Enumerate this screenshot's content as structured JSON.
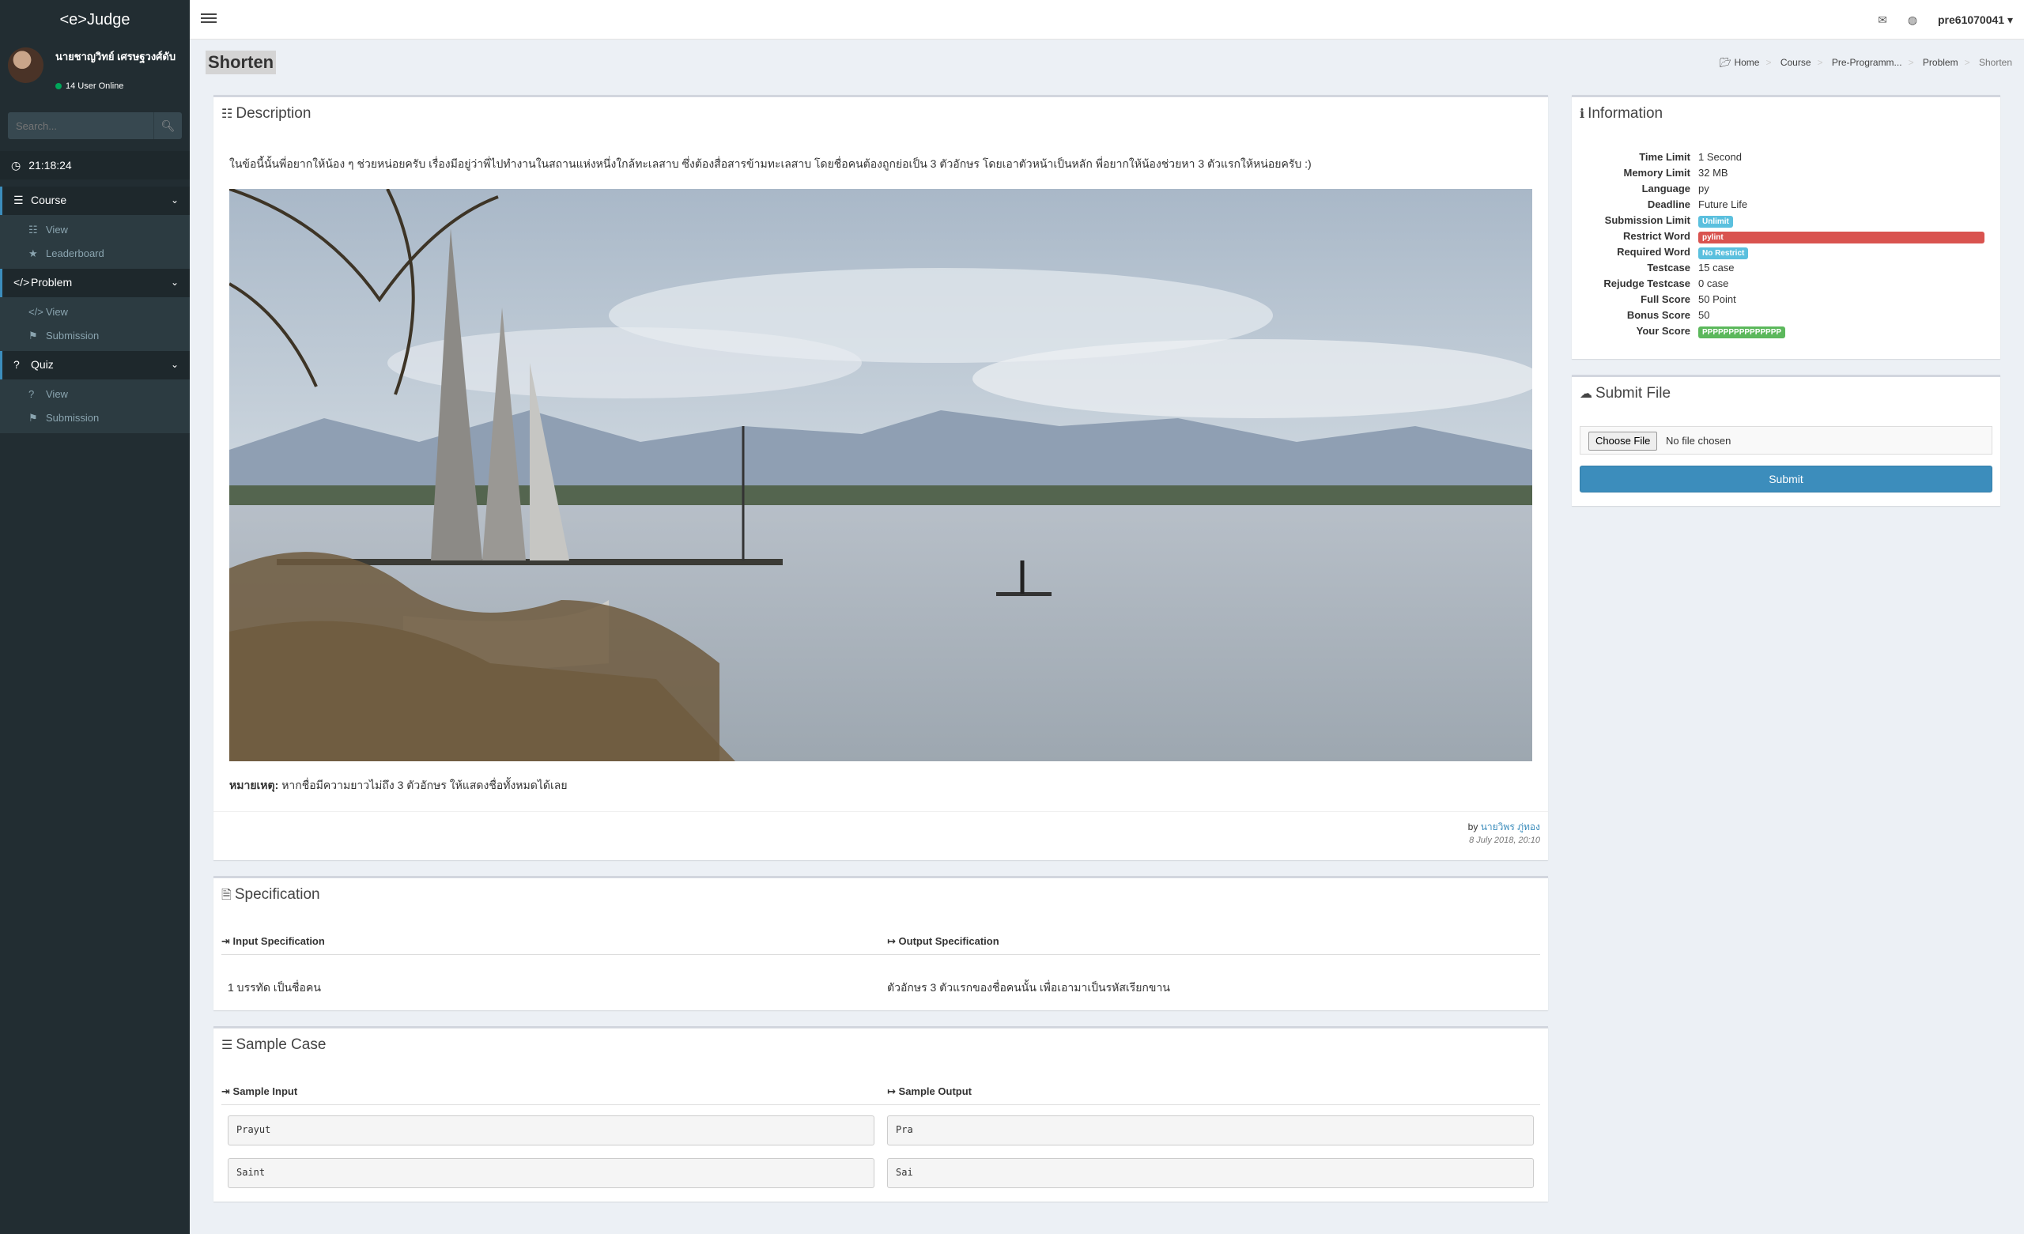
{
  "app": {
    "brand": "<e>Judge"
  },
  "user": {
    "name": "นายชาญวิทย์ เศรษฐวงศ์ดับ",
    "online": "14 User Online",
    "username": "pre61070041 ▾"
  },
  "search": {
    "placeholder": "Search..."
  },
  "clock": "21:18:24",
  "menu": [
    {
      "label": "Course",
      "icon": "list-icon",
      "items": [
        {
          "label": "View",
          "icon": "table-icon"
        },
        {
          "label": "Leaderboard",
          "icon": "trophy-icon"
        }
      ]
    },
    {
      "label": "Problem",
      "icon": "code-icon",
      "items": [
        {
          "label": "View",
          "icon": "code-icon"
        },
        {
          "label": "Submission",
          "icon": "flag-icon"
        }
      ]
    },
    {
      "label": "Quiz",
      "icon": "question-icon",
      "items": [
        {
          "label": "View",
          "icon": "question-icon"
        },
        {
          "label": "Submission",
          "icon": "flag-icon"
        }
      ]
    }
  ],
  "page": {
    "title": "Shorten"
  },
  "breadcrumb": [
    "Home",
    "Course",
    "Pre-Programm...",
    "Problem",
    "Shorten"
  ],
  "description": {
    "title": "Description",
    "text": "ในข้อนี้นั้นพี่อยากให้น้อง ๆ ช่วยหน่อยครับ เรื่องมีอยู่ว่าพี่ไปทำงานในสถานแห่งหนึ่งใกล้ทะเลสาบ ซึ่งต้องสื่อสารข้ามทะเลสาบ โดยชื่อคนต้องถูกย่อเป็น 3 ตัวอักษร โดยเอาตัวหน้าเป็นหลัก พี่อยากให้น้องช่วยหา 3 ตัวแรกให้หน่อยครับ :)",
    "note_label": "หมายเหตุ:",
    "note": "หากชื่อมีความยาวไม่ถึง 3 ตัวอักษร ให้แสดงชื่อทั้งหมดได้เลย",
    "by": "by",
    "author": "นายวิพร ภู่ทอง",
    "date": "8 July 2018, 20:10"
  },
  "specification": {
    "title": "Specification",
    "input_label": "Input Specification",
    "output_label": "Output Specification",
    "input": "1 บรรทัด เป็นชื่อคน",
    "output": "ตัวอักษร 3 ตัวแรกของชื่อคนนั้น เพื่อเอามาเป็นรหัสเรียกขาน"
  },
  "sample": {
    "title": "Sample Case",
    "input_label": "Sample Input",
    "output_label": "Sample Output",
    "cases": [
      {
        "input": "Prayut",
        "output": "Pra"
      },
      {
        "input": "Saint",
        "output": "Sai"
      }
    ]
  },
  "information": {
    "title": "Information",
    "rows": [
      {
        "k": "Time Limit",
        "v": "1 Second"
      },
      {
        "k": "Memory Limit",
        "v": "32 MB"
      },
      {
        "k": "Language",
        "v": "py"
      },
      {
        "k": "Deadline",
        "v": "Future Life"
      },
      {
        "k": "Submission Limit",
        "badge": "Unlimit"
      },
      {
        "k": "Restrict Word",
        "badge": "pylint"
      },
      {
        "k": "Required Word",
        "badge": "No Restrict"
      },
      {
        "k": "Testcase",
        "v": "15 case"
      },
      {
        "k": "Rejudge Testcase",
        "v": "0 case"
      },
      {
        "k": "Full Score",
        "v": "50 Point"
      },
      {
        "k": "Bonus Score",
        "v": "50"
      },
      {
        "k": "Your Score",
        "badge": "PPPPPPPPPPPPPPP"
      }
    ]
  },
  "submit": {
    "title": "Submit File",
    "choose": "Choose File",
    "none": "No file chosen",
    "button": "Submit"
  },
  "colors": {
    "sidebar": "#222d32",
    "accent": "#3c8dbc",
    "danger": "#d9534f",
    "info": "#5bc0de",
    "success": "#5cb85c"
  }
}
